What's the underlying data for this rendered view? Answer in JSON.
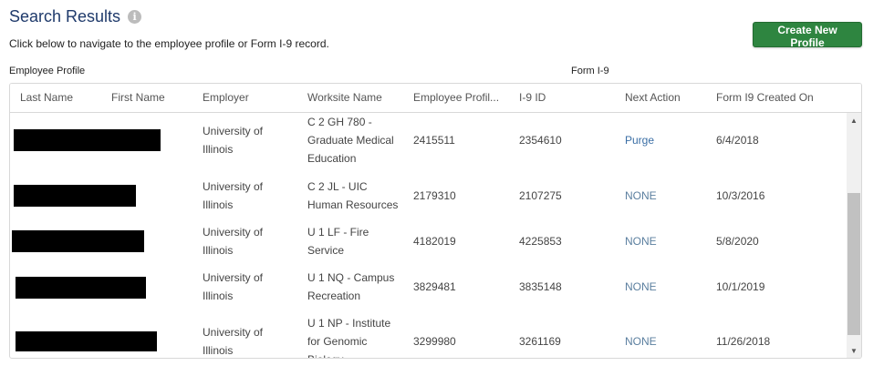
{
  "header": {
    "title": "Search Results",
    "info_icon": "i",
    "instructions": "Click below to navigate to the employee profile or Form I-9 record.",
    "create_button": "Create New Profile"
  },
  "sections": {
    "employee_profile": "Employee Profile",
    "form_i9": "Form I-9"
  },
  "columns": [
    "Last Name",
    "First Name",
    "Employer",
    "Worksite Name",
    "Employee Profil...",
    "I-9 ID",
    "Next Action",
    "Form I9 Created On"
  ],
  "rows": [
    {
      "employer": [
        "University of",
        "Illinois"
      ],
      "worksite": [
        "C 2 GH 780 -",
        "Graduate Medical",
        "Education"
      ],
      "profile_id": "2415511",
      "i9_id": "2354610",
      "next_action": "Purge",
      "created_on": "6/4/2018"
    },
    {
      "employer": [
        "University of",
        "Illinois"
      ],
      "worksite": [
        "C 2 JL - UIC",
        "Human Resources"
      ],
      "profile_id": "2179310",
      "i9_id": "2107275",
      "next_action": "NONE",
      "created_on": "10/3/2016"
    },
    {
      "employer": [
        "University of",
        "Illinois"
      ],
      "worksite": [
        "U 1 LF - Fire",
        "Service"
      ],
      "profile_id": "4182019",
      "i9_id": "4225853",
      "next_action": "NONE",
      "created_on": "5/8/2020"
    },
    {
      "employer": [
        "University of",
        "Illinois"
      ],
      "worksite": [
        "U 1 NQ - Campus",
        "Recreation"
      ],
      "profile_id": "3829481",
      "i9_id": "3835148",
      "next_action": "NONE",
      "created_on": "10/1/2019"
    },
    {
      "employer": [
        "University of",
        "Illinois"
      ],
      "worksite": [
        "U 1 NP - Institute",
        "for Genomic",
        "Biology"
      ],
      "profile_id": "3299980",
      "i9_id": "3261169",
      "next_action": "NONE",
      "created_on": "11/26/2018"
    }
  ],
  "scrollbar": {
    "up_arrow": "▲",
    "down_arrow": "▼"
  },
  "colors": {
    "title": "#1f3a6b",
    "button": "#2e8540",
    "link": "#3a6ea5"
  }
}
